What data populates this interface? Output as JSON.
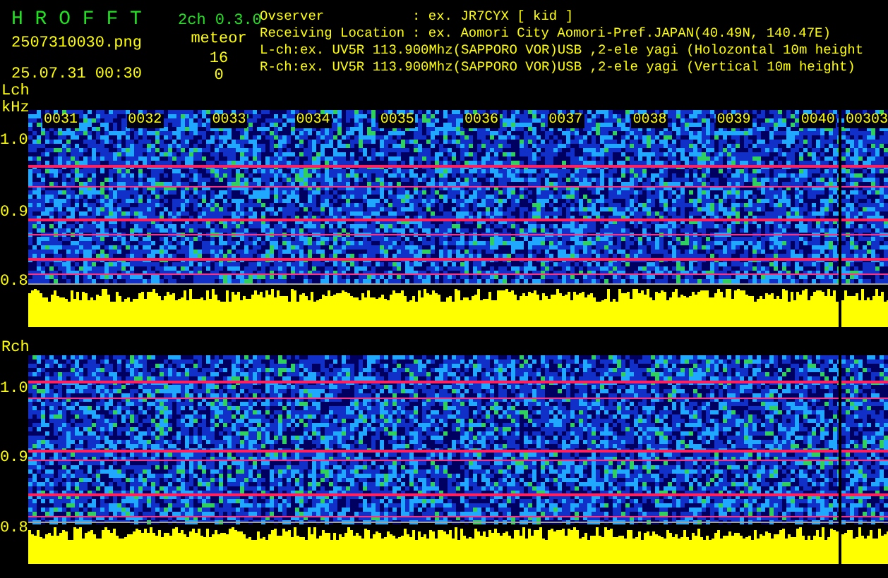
{
  "header": {
    "app_title": "H R O F F T",
    "version": "2ch 0.3.0",
    "file_name": "2507310030.png",
    "timestamp": "25.07.31 00:30",
    "counter_label": "meteor",
    "counts": [
      "16",
      "0"
    ],
    "info": [
      {
        "kind": "field",
        "label": "Ovserver",
        "value": ": ex. JR7CYX [ kid ]"
      },
      {
        "kind": "field",
        "label": "Receiving Location",
        "value": ": ex. Aomori City Aomori-Pref.JAPAN(40.49N, 140.47E)"
      },
      {
        "kind": "line",
        "text": "L-ch:ex. UV5R 113.900Mhz(SAPPORO VOR)USB ,2-ele yagi (Holozontal 10m height"
      },
      {
        "kind": "line",
        "text": "R-ch:ex. UV5R 113.900Mhz(SAPPORO VOR)USB ,2-ele yagi (Vertical 10m height)"
      }
    ]
  },
  "channels": [
    {
      "label": "Lch",
      "unit": "kHz",
      "y_labels": [
        "1.0",
        "0.9",
        "0.8"
      ],
      "time_labels": [
        "0031",
        "0032",
        "0033",
        "0034",
        "0035",
        "0036",
        "0037",
        "0038",
        "0039",
        "0040",
        "00303"
      ]
    },
    {
      "label": "Rch",
      "y_labels": [
        "1.0",
        "0.9",
        "0.8"
      ]
    }
  ]
}
